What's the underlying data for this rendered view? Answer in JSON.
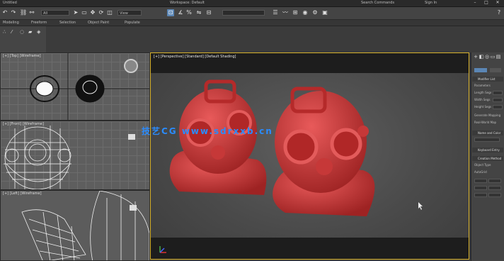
{
  "menubar": {
    "tabs": [
      "Untitled",
      "Workspace: Default",
      "Search Commands",
      "Sign In"
    ],
    "window_controls": [
      "–",
      "□",
      "✕"
    ]
  },
  "toolbar": {
    "undo_icon": "undo-icon",
    "redo_icon": "redo-icon",
    "selection_filter": "All",
    "view_dropdown": "View"
  },
  "ribbon": {
    "items": [
      "Modeling",
      "Freeform",
      "Selection",
      "Object Paint",
      "Populate"
    ]
  },
  "left_viewports": {
    "top_label": "[+] [Top] [Wireframe]",
    "front_label": "[+] [Front] [Wireframe]",
    "left_label": "[+] [Left] [Wireframe]"
  },
  "main_viewport": {
    "label": "[+] [Perspective] [Standard] [Default Shading]",
    "watermark": "技艺CG www.sdrxxb.cn"
  },
  "command_panel": {
    "tabs": [
      "+",
      "◧",
      "◎",
      "▭",
      "▤",
      "⚙"
    ],
    "section_title": "Modifier List",
    "rows": [
      "Parameters",
      "Length Segs",
      "Width Segs",
      "Height Segs",
      "Generate Mapping",
      "Real-World Map",
      "Name and Color",
      "Keyboard Entry",
      "Creation Method",
      "Object Type",
      "AutoGrid"
    ]
  },
  "colors": {
    "accent": "#5b86b5",
    "active_border": "#d8b22c",
    "watermark": "#2a8cff",
    "model": "#cf3a3a"
  }
}
